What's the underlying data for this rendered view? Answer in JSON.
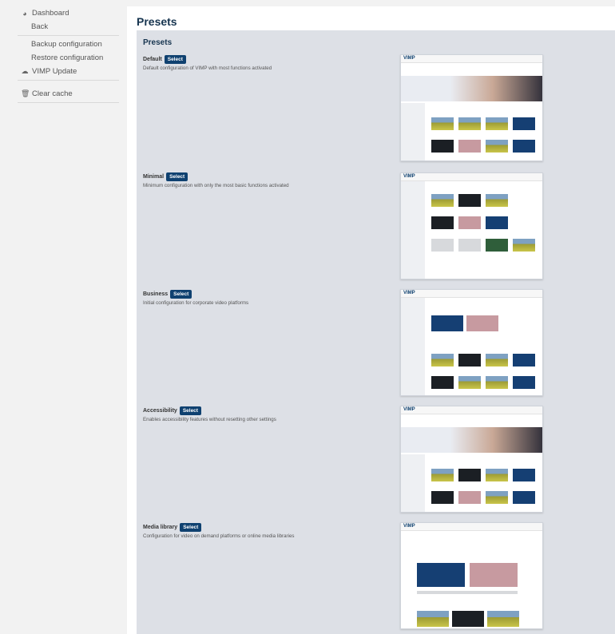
{
  "sidebar": {
    "dashboard": "Dashboard",
    "back": "Back",
    "backup": "Backup configuration",
    "restore": "Restore configuration",
    "vimp_update": "VIMP Update",
    "clear_cache": "Clear cache"
  },
  "page": {
    "title": "Presets",
    "panel_title": "Presets"
  },
  "presets": [
    {
      "name": "Default",
      "select_label": "Select",
      "description": "Default configuration of VIMP with most functions activated"
    },
    {
      "name": "Minimal",
      "select_label": "Select",
      "description": "Minimum configuration with only the most basic functions activated"
    },
    {
      "name": "Business",
      "select_label": "Select",
      "description": "Initial configuration for corporate video platforms"
    },
    {
      "name": "Accessibility",
      "select_label": "Select",
      "description": "Enables accessibility features without resetting other settings"
    },
    {
      "name": "Media library",
      "select_label": "Select",
      "description": "Configuration for video on demand platforms or online media libraries"
    }
  ],
  "thumbnail": {
    "logo": "VIMP"
  },
  "colors": {
    "accent": "#0f4170",
    "title": "#16344f",
    "panel_bg": "#dde0e6"
  },
  "icons": [
    "dashboard-icon",
    "cloud-upload-icon",
    "trash-icon"
  ]
}
